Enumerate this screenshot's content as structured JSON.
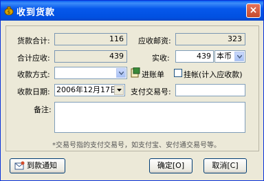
{
  "window": {
    "title": "收到货款",
    "close_label": "×"
  },
  "fields": {
    "goods_total": {
      "label": "货款合计:",
      "value": "116"
    },
    "postage_due": {
      "label": "应收邮资:",
      "value": "323"
    },
    "total_receivable": {
      "label": "合计应收:",
      "value": "439"
    },
    "actual_received": {
      "label": "实收:",
      "value": "439",
      "currency": "本币"
    },
    "payment_method": {
      "label": "收款方式:",
      "value": ""
    },
    "account_link": {
      "label": "进账单"
    },
    "on_credit": {
      "label": "挂帐(计入应收款)",
      "checked": false
    },
    "receipt_date": {
      "label": "收款日期:",
      "value": "2006年12月17日"
    },
    "transaction_no": {
      "label": "支付交易号:",
      "value": ""
    },
    "remarks": {
      "label": "备注:",
      "value": ""
    }
  },
  "hint": "*交易号指的支付交易号，如支付宝、安付通交易号等。",
  "buttons": {
    "notify": "到款通知",
    "ok": "确定[O]",
    "cancel": "取消[C]"
  },
  "icons": {
    "title": "money-bag-icon",
    "account": "deposit-slip-icon",
    "notify": "mail-notify-icon"
  }
}
